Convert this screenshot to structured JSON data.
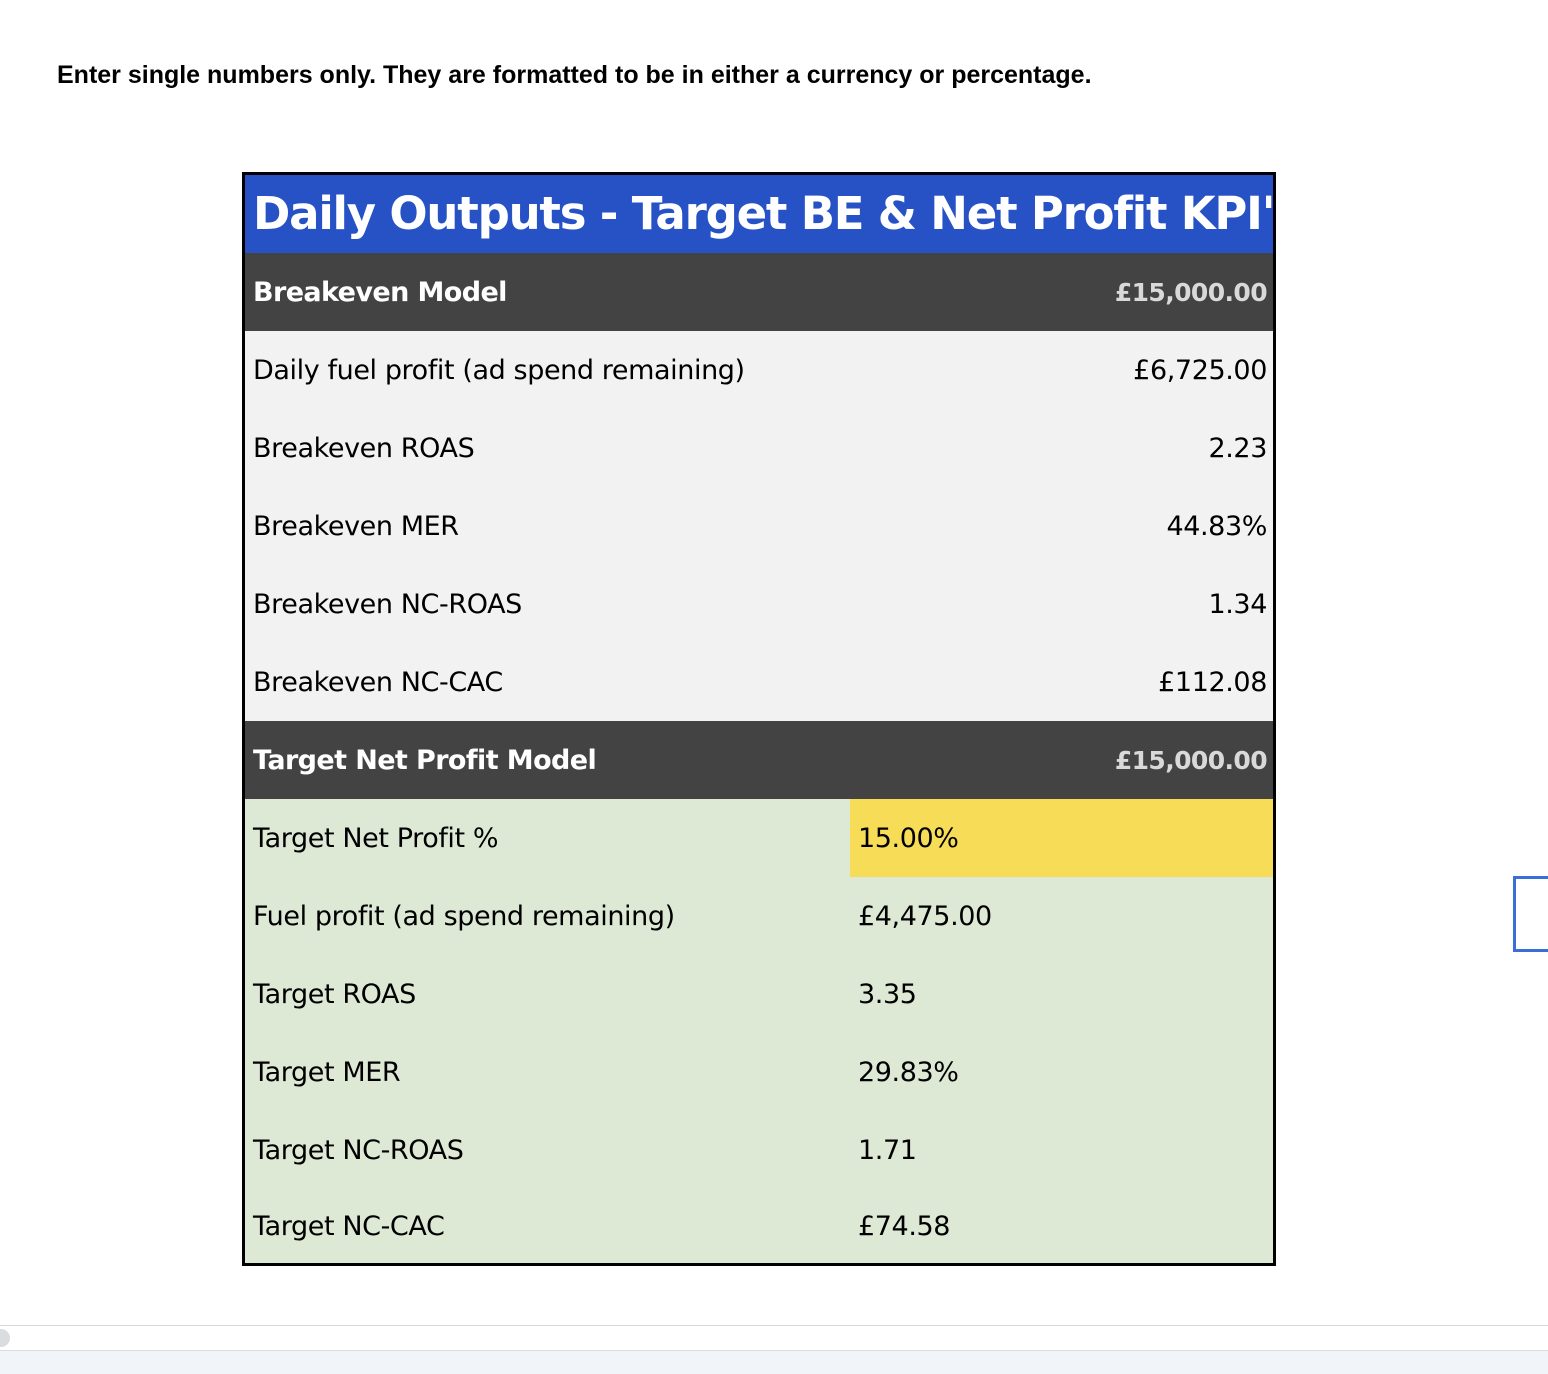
{
  "instructions": "Enter single numbers only. They are formatted to be in either a currency or percentage.",
  "table": {
    "title": "Daily Outputs - Target BE & Net Profit KPI's",
    "breakeven": {
      "header_label": "Breakeven Model",
      "header_value": "£15,000.00",
      "rows": [
        {
          "label": "Daily fuel profit (ad spend remaining)",
          "value": "£6,725.00"
        },
        {
          "label": "Breakeven ROAS",
          "value": "2.23"
        },
        {
          "label": "Breakeven MER",
          "value": "44.83%"
        },
        {
          "label": "Breakeven NC-ROAS",
          "value": "1.34"
        },
        {
          "label": "Breakeven NC-CAC",
          "value": "£112.08"
        }
      ]
    },
    "target": {
      "header_label": "Target Net Profit Model",
      "header_value": "£15,000.00",
      "rows": [
        {
          "label": "Target Net Profit %",
          "value": "15.00%"
        },
        {
          "label": "Fuel profit (ad spend remaining)",
          "value": "£4,475.00"
        },
        {
          "label": "Target ROAS",
          "value": "3.35"
        },
        {
          "label": "Target MER",
          "value": "29.83%"
        },
        {
          "label": "Target NC-ROAS",
          "value": "1.71"
        },
        {
          "label": "Target NC-CAC",
          "value": "£74.58"
        }
      ]
    }
  },
  "colors": {
    "title_bg": "#2652c6",
    "section_bg": "#434343",
    "breakeven_bg": "#f2f2f2",
    "target_bg": "#dde8d5",
    "input_highlight": "#f7dc58",
    "selection_border": "#3b6fd6"
  }
}
